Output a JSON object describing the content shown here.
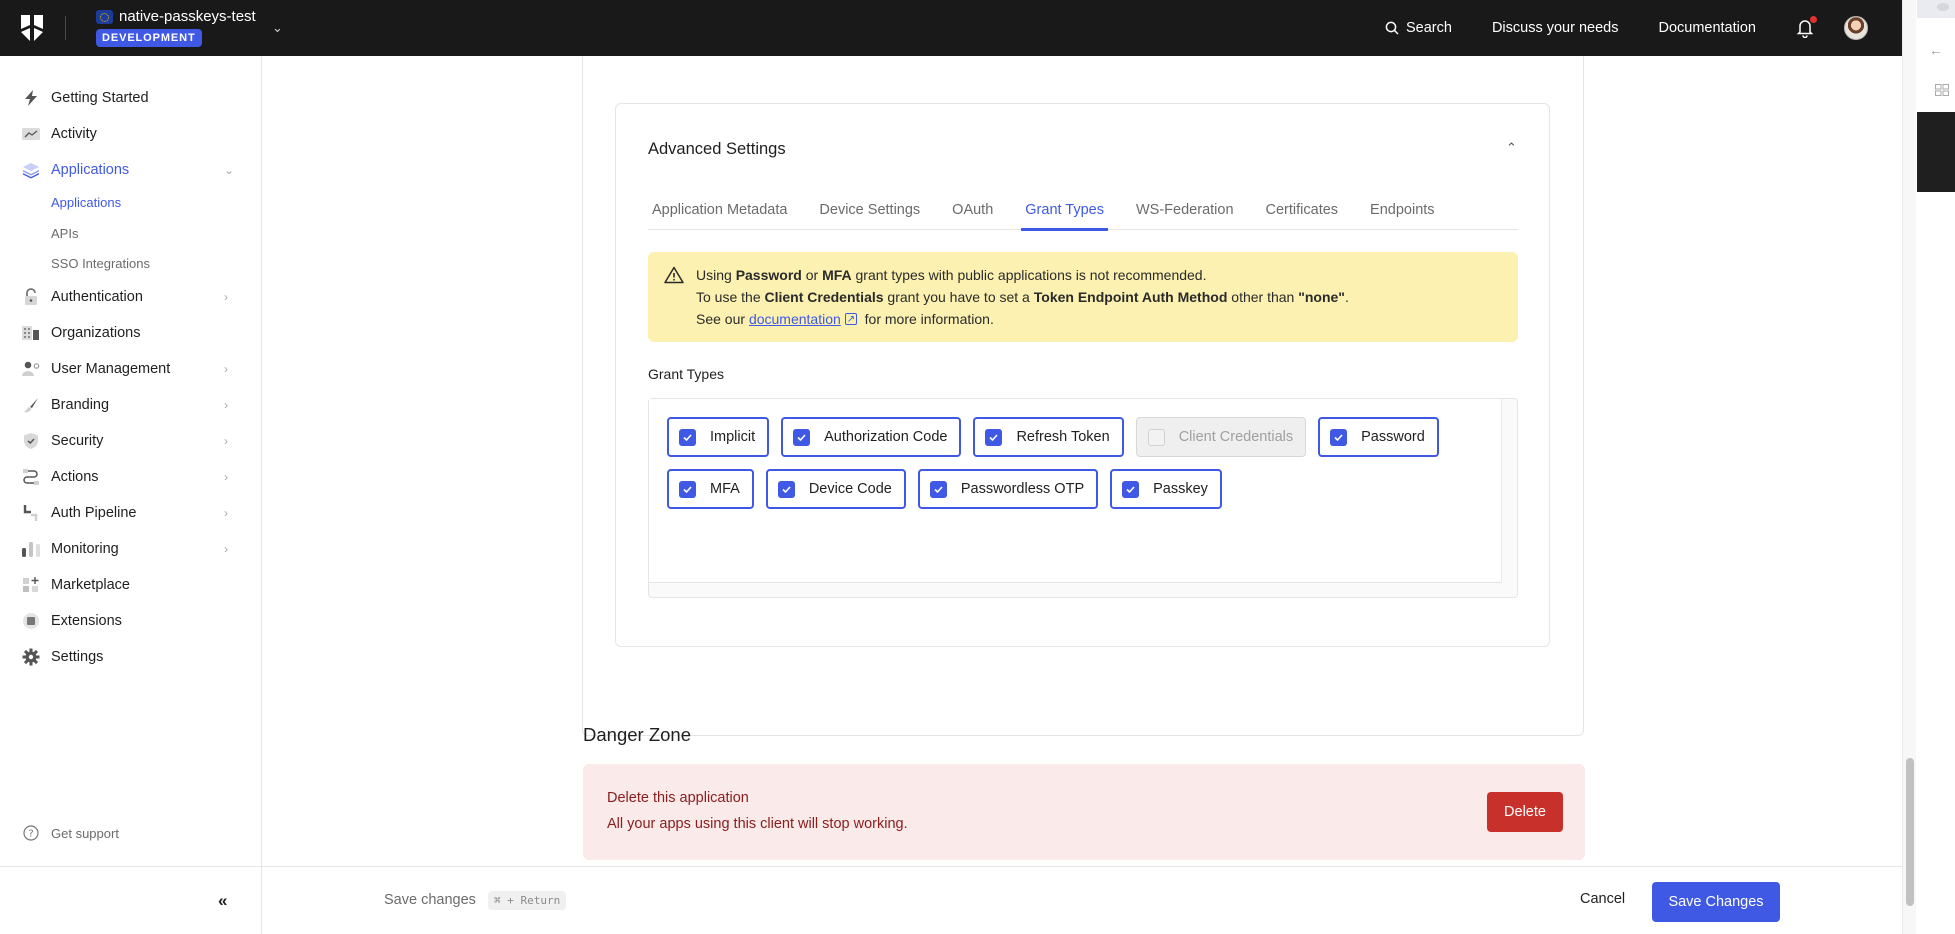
{
  "topbar": {
    "tenant_name": "native-passkeys-test",
    "environment_badge": "DEVELOPMENT",
    "search_label": "Search",
    "discuss_label": "Discuss your needs",
    "docs_label": "Documentation",
    "notification_indicator": true
  },
  "sidebar": {
    "items": [
      {
        "label": "Getting Started",
        "icon": "lightning-icon"
      },
      {
        "label": "Activity",
        "icon": "activity-chart-icon"
      },
      {
        "label": "Applications",
        "icon": "layers-icon",
        "active": true,
        "expanded": true
      },
      {
        "label": "Authentication",
        "icon": "lock-icon"
      },
      {
        "label": "Organizations",
        "icon": "building-icon"
      },
      {
        "label": "User Management",
        "icon": "user-gear-icon"
      },
      {
        "label": "Branding",
        "icon": "brush-icon"
      },
      {
        "label": "Security",
        "icon": "shield-check-icon"
      },
      {
        "label": "Actions",
        "icon": "flow-icon"
      },
      {
        "label": "Auth Pipeline",
        "icon": "pipeline-icon"
      },
      {
        "label": "Monitoring",
        "icon": "bar-chart-icon"
      },
      {
        "label": "Marketplace",
        "icon": "grid-plus-icon"
      },
      {
        "label": "Extensions",
        "icon": "chip-icon"
      },
      {
        "label": "Settings",
        "icon": "gear-icon"
      }
    ],
    "sub_items": [
      {
        "label": "Applications",
        "active": true
      },
      {
        "label": "APIs"
      },
      {
        "label": "SSO Integrations"
      }
    ],
    "support_label": "Get support",
    "collapse_label": "«"
  },
  "advanced_settings": {
    "title": "Advanced Settings",
    "tabs": [
      {
        "label": "Application Metadata"
      },
      {
        "label": "Device Settings"
      },
      {
        "label": "OAuth"
      },
      {
        "label": "Grant Types",
        "active": true
      },
      {
        "label": "WS-Federation"
      },
      {
        "label": "Certificates"
      },
      {
        "label": "Endpoints"
      }
    ],
    "warning": {
      "line1_pre": "Using ",
      "line1_b1": "Password",
      "line1_mid": " or ",
      "line1_b2": "MFA",
      "line1_post": " grant types with public applications is not recommended.",
      "line2_pre": "To use the ",
      "line2_b1": "Client Credentials",
      "line2_mid": " grant you have to set a ",
      "line2_b2": "Token Endpoint Auth Method",
      "line2_mid2": " other than ",
      "line2_b3": "\"none\"",
      "line2_post": ".",
      "line3_pre": "See our ",
      "line3_link": "documentation",
      "line3_post": " for more information."
    },
    "grant_types_label": "Grant Types",
    "grant_types": [
      {
        "label": "Implicit",
        "checked": true,
        "disabled": false
      },
      {
        "label": "Authorization Code",
        "checked": true,
        "disabled": false
      },
      {
        "label": "Refresh Token",
        "checked": true,
        "disabled": false
      },
      {
        "label": "Client Credentials",
        "checked": false,
        "disabled": true
      },
      {
        "label": "Password",
        "checked": true,
        "disabled": false
      },
      {
        "label": "MFA",
        "checked": true,
        "disabled": false
      },
      {
        "label": "Device Code",
        "checked": true,
        "disabled": false
      },
      {
        "label": "Passwordless OTP",
        "checked": true,
        "disabled": false
      },
      {
        "label": "Passkey",
        "checked": true,
        "disabled": false
      }
    ]
  },
  "danger_zone": {
    "title": "Danger Zone",
    "heading": "Delete this application",
    "description": "All your apps using this client will stop working.",
    "delete_label": "Delete"
  },
  "bottombar": {
    "save_hint": "Save changes",
    "shortcut": "⌘ + Return",
    "cancel_label": "Cancel",
    "save_label": "Save Changes"
  },
  "colors": {
    "accent": "#3f59e4",
    "topbar_bg": "#191919",
    "warning_bg": "#fcf1b0",
    "danger_bg": "#fbeaea",
    "danger_button": "#c8302b"
  }
}
